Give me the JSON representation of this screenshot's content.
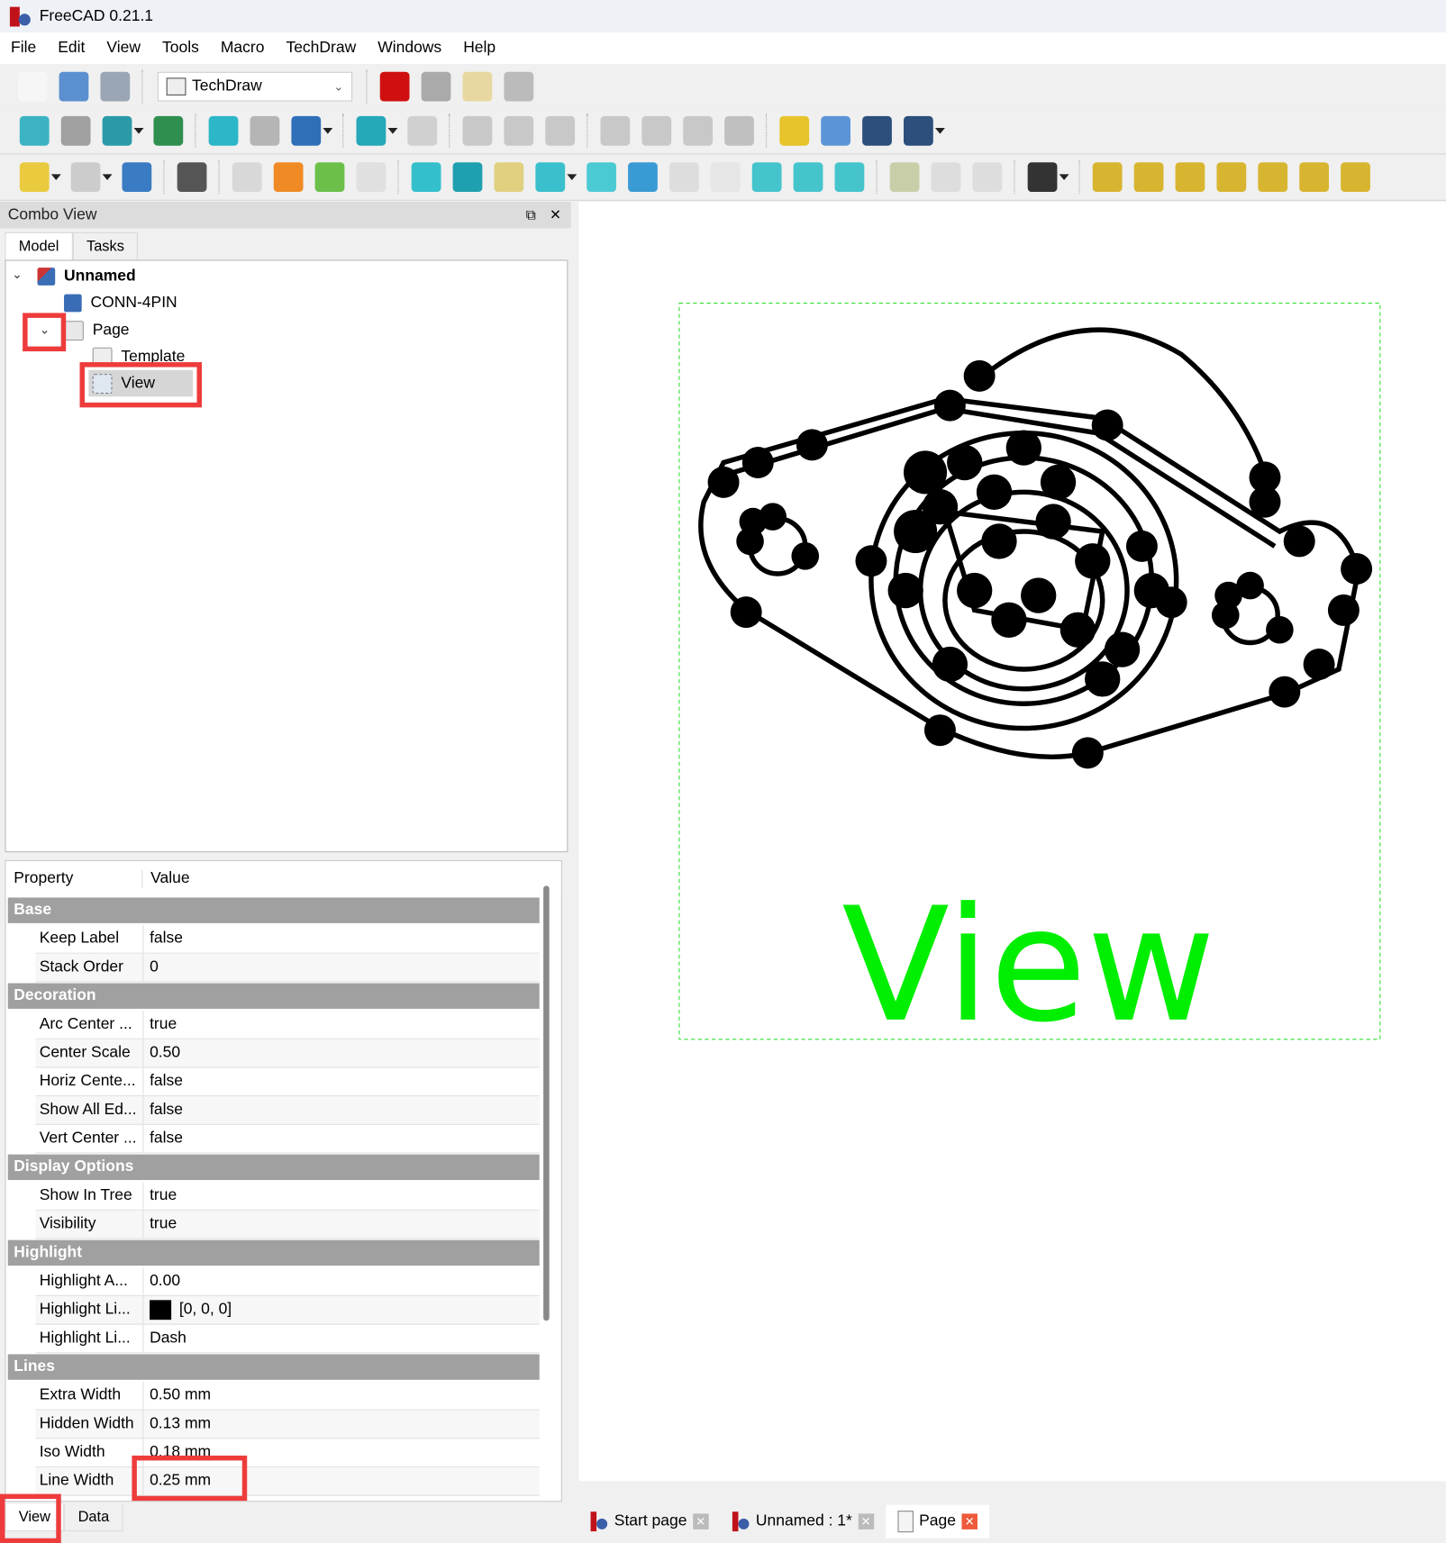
{
  "window": {
    "title": "FreeCAD 0.21.1"
  },
  "menu": [
    "File",
    "Edit",
    "View",
    "Tools",
    "Macro",
    "TechDraw",
    "Windows",
    "Help"
  ],
  "toolbar1": {
    "icons_left": [
      {
        "name": "new-document-icon",
        "color": "#f6f6f6"
      },
      {
        "name": "open-folder-icon",
        "color": "#5b8fd0"
      },
      {
        "name": "save-icon",
        "color": "#9aa6b4"
      }
    ],
    "workbench": "TechDraw",
    "icons_right": [
      {
        "name": "record-macro-icon",
        "color": "#d01010"
      },
      {
        "name": "stop-macro-icon",
        "color": "#aaaaaa"
      },
      {
        "name": "edit-macro-icon",
        "color": "#e8d7a0"
      },
      {
        "name": "run-macro-icon",
        "color": "#bbbbbb"
      }
    ]
  },
  "toolbar2": [
    {
      "name": "fit-all-icon",
      "color": "#3bb3c3"
    },
    {
      "name": "fit-selection-icon",
      "color": "#a0a0a0"
    },
    {
      "name": "draw-style-icon",
      "color": "#2a9aa8",
      "dd": true
    },
    {
      "name": "bounding-box-icon",
      "color": "#2f8f4f",
      "sep": true
    },
    {
      "name": "back-arrow-icon",
      "color": "#2cb6c8"
    },
    {
      "name": "forward-arrow-icon",
      "color": "#b5b5b5"
    },
    {
      "name": "sync-view-icon",
      "color": "#2f6fb7",
      "dd": true,
      "sep": true
    },
    {
      "name": "zoom-icon",
      "color": "#25a8b8",
      "dd": true
    },
    {
      "name": "isometric-view-icon",
      "color": "#d0d0d0",
      "sep": true
    },
    {
      "name": "front-view-icon",
      "color": "#c8c8c8"
    },
    {
      "name": "top-view-icon",
      "color": "#c8c8c8"
    },
    {
      "name": "right-view-icon",
      "color": "#c8c8c8",
      "sep": true
    },
    {
      "name": "rear-view-icon",
      "color": "#c8c8c8"
    },
    {
      "name": "bottom-view-icon",
      "color": "#c8c8c8"
    },
    {
      "name": "left-view-icon",
      "color": "#c8c8c8"
    },
    {
      "name": "measure-icon",
      "color": "#c0c0c0",
      "sep": true
    },
    {
      "name": "part-icon",
      "color": "#e6c42a"
    },
    {
      "name": "group-folder-icon",
      "color": "#5b95d6"
    },
    {
      "name": "link-icon",
      "color": "#2c4f7c"
    },
    {
      "name": "link-actions-icon",
      "color": "#2c4f7c",
      "dd": true
    }
  ],
  "toolbar3": [
    {
      "name": "undo-icon",
      "color": "#eacb40",
      "dd": true
    },
    {
      "name": "redo-icon",
      "color": "#cccccc",
      "dd": true
    },
    {
      "name": "refresh-icon",
      "color": "#3a7cc4",
      "sep": true
    },
    {
      "name": "whats-this-icon",
      "color": "#555555",
      "sep": true
    },
    {
      "name": "new-page-icon",
      "color": "#d8d8d8"
    },
    {
      "name": "new-page-template-icon",
      "color": "#f08a24"
    },
    {
      "name": "redraw-page-icon",
      "color": "#6cc04a"
    },
    {
      "name": "print-all-icon",
      "color": "#e0e0e0",
      "sep": true
    },
    {
      "name": "insert-view-icon",
      "color": "#33c0cc"
    },
    {
      "name": "active-view-icon",
      "color": "#1fa0b0"
    },
    {
      "name": "projection-group-icon",
      "color": "#e0d080"
    },
    {
      "name": "section-view-icon",
      "color": "#3ac0cc",
      "dd": true
    },
    {
      "name": "detail-view-icon",
      "color": "#4ccad4"
    },
    {
      "name": "clip-group-icon",
      "color": "#3a9ad4"
    },
    {
      "name": "symbol-icon",
      "color": "#dddddd"
    },
    {
      "name": "spreadsheet-view-icon",
      "color": "#e6e6e6"
    },
    {
      "name": "arch-view-icon",
      "color": "#45c4cc"
    },
    {
      "name": "draft-view-icon",
      "color": "#45c4cc"
    },
    {
      "name": "shape-view-icon",
      "color": "#45c4cc",
      "sep": true
    },
    {
      "name": "clip-group-add-icon",
      "color": "#c8cfa8"
    },
    {
      "name": "clip-add-icon",
      "color": "#dddddd"
    },
    {
      "name": "clip-remove-icon",
      "color": "#dddddd",
      "sep": true
    },
    {
      "name": "stacking-icon",
      "color": "#333333",
      "dd": true,
      "sep": true
    },
    {
      "name": "length-dimension-icon",
      "color": "#d8b530"
    },
    {
      "name": "horizontal-dimension-icon",
      "color": "#d8b530"
    },
    {
      "name": "vertical-dimension-icon",
      "color": "#d8b530"
    },
    {
      "name": "radius-dimension-icon",
      "color": "#d8b530"
    },
    {
      "name": "diameter-dimension-icon",
      "color": "#d8b530"
    },
    {
      "name": "angle-dimension-icon",
      "color": "#d8b530"
    },
    {
      "name": "three-point-angle-icon",
      "color": "#d8b530"
    }
  ],
  "combo_view": {
    "title": "Combo View",
    "tabs": [
      "Model",
      "Tasks"
    ]
  },
  "tree": {
    "root": "Unnamed",
    "items": [
      "CONN-4PIN",
      "Page",
      "Template",
      "View"
    ]
  },
  "properties": {
    "headers": [
      "Property",
      "Value"
    ],
    "groups": [
      {
        "name": "Base",
        "rows": [
          [
            "Keep Label",
            "false"
          ],
          [
            "Stack Order",
            "0"
          ]
        ]
      },
      {
        "name": "Decoration",
        "rows": [
          [
            "Arc Center ...",
            "true"
          ],
          [
            "Center Scale",
            "0.50"
          ],
          [
            "Horiz Cente...",
            "false"
          ],
          [
            "Show All Ed...",
            "false"
          ],
          [
            "Vert Center ...",
            "false"
          ]
        ]
      },
      {
        "name": "Display Options",
        "rows": [
          [
            "Show In Tree",
            "true"
          ],
          [
            "Visibility",
            "true"
          ]
        ]
      },
      {
        "name": "Highlight",
        "rows": [
          [
            "Highlight A...",
            "0.00"
          ],
          [
            "Highlight Li...",
            "[0, 0, 0]"
          ],
          [
            "Highlight Li...",
            "Dash"
          ]
        ]
      },
      {
        "name": "Lines",
        "rows": [
          [
            "Extra Width",
            "0.50 mm"
          ],
          [
            "Hidden Width",
            "0.13 mm"
          ],
          [
            "Iso Width",
            "0.18 mm"
          ],
          [
            "Line Width",
            "0.25 mm"
          ]
        ]
      }
    ],
    "swatch_color": "#000000",
    "bottom_tabs": [
      "View",
      "Data"
    ]
  },
  "drawing": {
    "label": "View",
    "label_color": "#00ee00",
    "frame_color": "#33dd33"
  },
  "doc_tabs": [
    "Start page",
    "Unnamed : 1*",
    "Page"
  ],
  "highlight_color": "#ee3b3b"
}
